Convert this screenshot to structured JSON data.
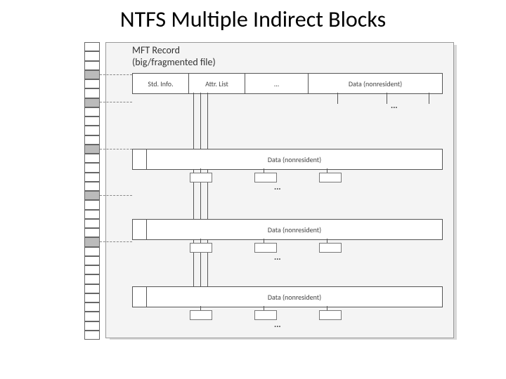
{
  "title": "NTFS Multiple Indirect Blocks",
  "mft_label_line1": "MFT Record",
  "mft_label_line2": "(big/fragmented file)",
  "cells": {
    "std_info": "Std. Info.",
    "attr_list": "Attr. List",
    "ellipsis": "...",
    "data_nonres": "Data (nonresident)"
  },
  "mft_slots": 32,
  "highlighted_slots": [
    3,
    6,
    11,
    16,
    21
  ]
}
